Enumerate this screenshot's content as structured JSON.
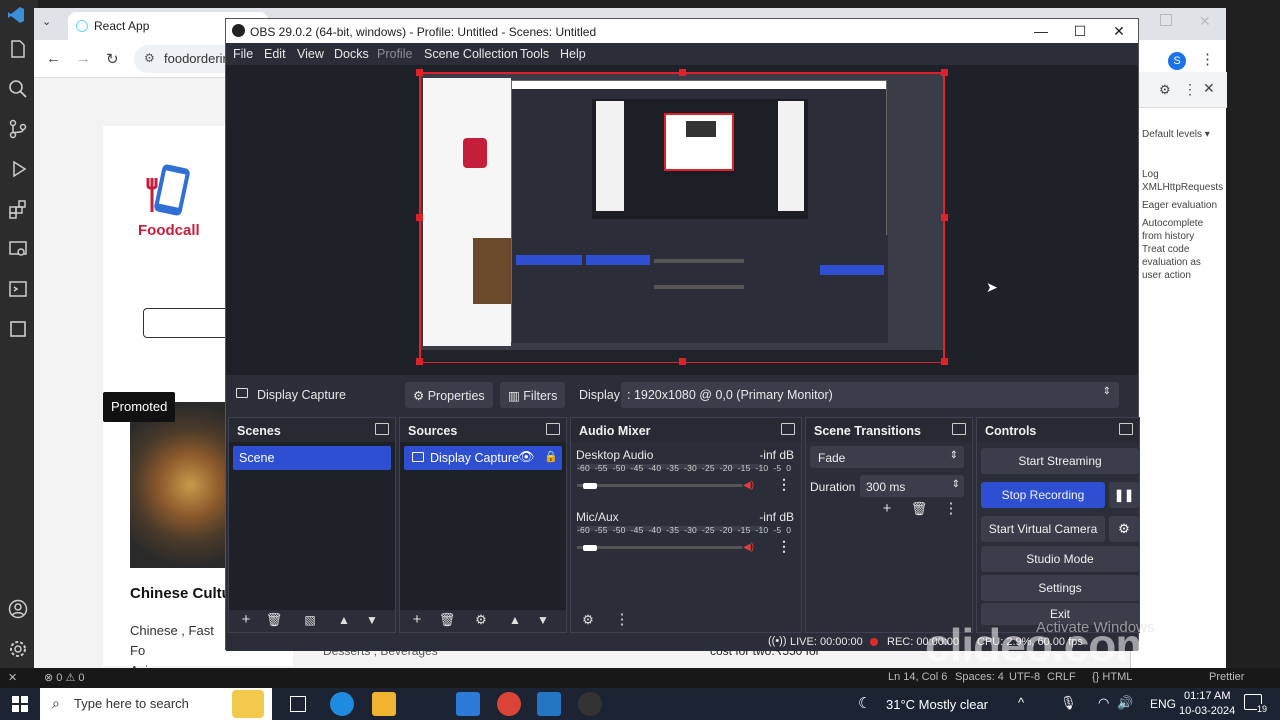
{
  "browser": {
    "tab_title": "React App",
    "url": "foodorderin",
    "devtools": {
      "levels": "Default levels ▾",
      "items": [
        "Log",
        "XMLHttpRequests",
        "Eager evaluation",
        "Autocomplete",
        "from history",
        "Treat code",
        "evaluation as",
        "user action"
      ]
    },
    "page": {
      "brand": "Foodcall",
      "promoted": "Promoted",
      "dish_title": "Chinese Cultu",
      "dish_cuisine_line1": "Chinese , Fast Fo",
      "dish_cuisine_line2": "Asian",
      "bottom_text_1": "Desserts , Beverages",
      "bottom_text_2": "cost for two:₹550 for"
    }
  },
  "obs": {
    "title": "OBS 29.0.2 (64-bit, windows) - Profile: Untitled - Scenes: Untitled",
    "menu": [
      "File",
      "Edit",
      "View",
      "Docks",
      "Profile",
      "Scene Collection",
      "Tools",
      "Help"
    ],
    "source_toolbar": {
      "source_name": "Display Capture",
      "properties": "Properties",
      "filters": "Filters",
      "display_label": "Display",
      "display_value": ": 1920x1080 @ 0,0 (Primary Monitor)"
    },
    "docks": {
      "scenes": {
        "title": "Scenes",
        "items": [
          "Scene"
        ]
      },
      "sources": {
        "title": "Sources",
        "items": [
          "Display Capture"
        ]
      },
      "audio_mixer": {
        "title": "Audio Mixer",
        "scale": "-60 -55 -50 -45 -40 -35 -30 -25 -20 -15 -10 -5 0",
        "channels": [
          {
            "name": "Desktop Audio",
            "level": "-inf dB",
            "volume": 0.08
          },
          {
            "name": "Mic/Aux",
            "level": "-inf dB",
            "volume": 0.08
          }
        ]
      },
      "scene_transitions": {
        "title": "Scene Transitions",
        "transition": "Fade",
        "duration_label": "Duration",
        "duration_value": "300 ms"
      },
      "controls": {
        "title": "Controls",
        "buttons": [
          "Start Streaming",
          "Stop Recording",
          "Start Virtual Camera",
          "Studio Mode",
          "Settings",
          "Exit"
        ]
      }
    },
    "status": {
      "live": "LIVE: 00:00:00",
      "rec": "REC: 00:00:00",
      "cpu": "CPU: 2.9%, 60.00 fps"
    }
  },
  "vscode_status": {
    "left": "⊗ 0 ⚠ 0",
    "right": [
      "Ln 14, Col 6",
      "Spaces: 4",
      "UTF-8",
      "CRLF",
      "{} HTML",
      "Prettier"
    ]
  },
  "watermark": {
    "brand": "clideo.com",
    "activate": "Activate Windows"
  },
  "taskbar": {
    "search_placeholder": "Type here to search",
    "weather": "31°C  Mostly clear",
    "lang": "ENG",
    "time": "01:17 AM",
    "date": "10-03-2024",
    "notifications": "19"
  }
}
